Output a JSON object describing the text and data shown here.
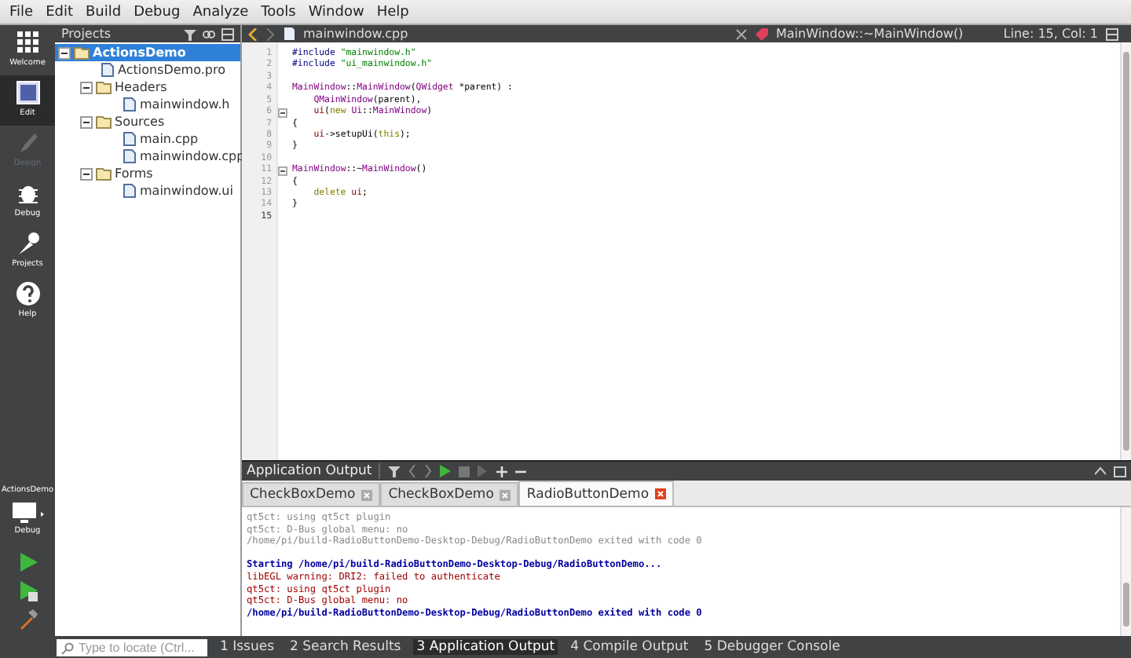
{
  "menu": [
    "File",
    "Edit",
    "Build",
    "Debug",
    "Analyze",
    "Tools",
    "Window",
    "Help"
  ],
  "modes": [
    {
      "label": "Welcome",
      "selected": false,
      "disabled": false
    },
    {
      "label": "Edit",
      "selected": true,
      "disabled": false
    },
    {
      "label": "Design",
      "selected": false,
      "disabled": true
    },
    {
      "label": "Debug",
      "selected": false,
      "disabled": false
    },
    {
      "label": "Projects",
      "selected": false,
      "disabled": false
    },
    {
      "label": "Help",
      "selected": false,
      "disabled": false
    }
  ],
  "target": {
    "project": "ActionsDemo",
    "config": "Debug"
  },
  "projects": {
    "title": "Projects",
    "tree": [
      {
        "label": "ActionsDemo",
        "selected": true,
        "expanded": true,
        "children": [
          {
            "label": "ActionsDemo.pro",
            "selected": false
          },
          {
            "label": "Headers",
            "selected": false,
            "expanded": true,
            "children": [
              {
                "label": "mainwindow.h",
                "selected": false
              }
            ]
          },
          {
            "label": "Sources",
            "selected": false,
            "expanded": true,
            "children": [
              {
                "label": "main.cpp",
                "selected": false
              },
              {
                "label": "mainwindow.cpp",
                "selected": false
              }
            ]
          },
          {
            "label": "Forms",
            "selected": false,
            "expanded": true,
            "children": [
              {
                "label": "mainwindow.ui",
                "selected": false
              }
            ]
          }
        ]
      }
    ]
  },
  "editor": {
    "file": "mainwindow.cpp",
    "symbol": "MainWindow::~MainWindow()",
    "position": "Line: 15, Col: 1",
    "lines": [
      {
        "number": "1",
        "indented": false,
        "foldable": false,
        "tokens": [
          {
            "text": "#include",
            "kind": "preproc"
          },
          {
            "text": " \"mainwindow.h\"",
            "kind": "string"
          }
        ]
      },
      {
        "number": "2",
        "indented": false,
        "foldable": false,
        "tokens": [
          {
            "text": "#include",
            "kind": "preproc"
          },
          {
            "text": " \"ui_mainwindow.h\"",
            "kind": "string"
          }
        ]
      },
      {
        "number": "3",
        "foldable": false
      },
      {
        "number": "4",
        "indented": false,
        "foldable": false,
        "tokens": [
          {
            "text": "MainWindow",
            "kind": "type"
          },
          {
            "text": "::",
            "kind": "plain"
          },
          {
            "text": "MainWindow",
            "kind": "type"
          },
          {
            "text": "(",
            "kind": "plain"
          },
          {
            "text": "QWidget",
            "kind": "type"
          },
          {
            "text": " *parent) :",
            "kind": "plain"
          }
        ]
      },
      {
        "number": "5",
        "indented": true,
        "foldable": false,
        "tokens": [
          {
            "text": "QMainWindow",
            "kind": "type"
          },
          {
            "text": "(parent),",
            "kind": "plain"
          }
        ]
      },
      {
        "number": "6",
        "indented": true,
        "foldable": true,
        "tokens": [
          {
            "text": "ui",
            "kind": "member"
          },
          {
            "text": "(",
            "kind": "plain"
          },
          {
            "text": "new",
            "kind": "keyword"
          },
          {
            "text": " Ui",
            "kind": "type"
          },
          {
            "text": "::",
            "kind": "plain"
          },
          {
            "text": "MainWindow",
            "kind": "type"
          },
          {
            "text": ")",
            "kind": "plain"
          }
        ]
      },
      {
        "number": "7",
        "indented": false,
        "foldable": false,
        "tokens": [
          {
            "text": "{",
            "kind": "plain"
          }
        ]
      },
      {
        "number": "8",
        "indented": true,
        "foldable": false,
        "tokens": [
          {
            "text": "ui",
            "kind": "member"
          },
          {
            "text": "->setupUi(",
            "kind": "plain"
          },
          {
            "text": "this",
            "kind": "keyword"
          },
          {
            "text": ");",
            "kind": "plain"
          }
        ]
      },
      {
        "number": "9",
        "indented": false,
        "foldable": false,
        "tokens": [
          {
            "text": "}",
            "kind": "plain"
          }
        ]
      },
      {
        "number": "10",
        "foldable": false
      },
      {
        "number": "11",
        "indented": false,
        "foldable": true,
        "tokens": [
          {
            "text": "MainWindow",
            "kind": "type"
          },
          {
            "text": "::~",
            "kind": "plain"
          },
          {
            "text": "MainWindow",
            "kind": "type"
          },
          {
            "text": "()",
            "kind": "plain"
          }
        ]
      },
      {
        "number": "12",
        "indented": false,
        "foldable": false,
        "tokens": [
          {
            "text": "{",
            "kind": "plain"
          }
        ]
      },
      {
        "number": "13",
        "indented": true,
        "foldable": false,
        "tokens": [
          {
            "text": "delete",
            "kind": "keyword"
          },
          {
            "text": " ui",
            "kind": "member"
          },
          {
            "text": ";",
            "kind": "plain"
          }
        ]
      },
      {
        "number": "14",
        "indented": false,
        "foldable": false,
        "tokens": [
          {
            "text": "}",
            "kind": "plain"
          }
        ]
      },
      {
        "number": "15",
        "foldable": false
      }
    ]
  },
  "output": {
    "title": "Application Output",
    "tabs": [
      {
        "label": "CheckBoxDemo",
        "selected": false
      },
      {
        "label": "CheckBoxDemo",
        "selected": false
      },
      {
        "label": "RadioButtonDemo",
        "selected": true
      }
    ],
    "lines": [
      {
        "kind": "old",
        "text": "qt5ct: using qt5ct plugin"
      },
      {
        "kind": "old",
        "text": "qt5ct: D-Bus global menu: no"
      },
      {
        "kind": "old",
        "text": "/home/pi/build-RadioButtonDemo-Desktop-Debug/RadioButtonDemo exited with code 0"
      },
      {
        "kind": "blank"
      },
      {
        "kind": "info",
        "text": "Starting /home/pi/build-RadioButtonDemo-Desktop-Debug/RadioButtonDemo..."
      },
      {
        "kind": "error",
        "text": "libEGL warning: DRI2: failed to authenticate"
      },
      {
        "kind": "error",
        "text": "qt5ct: using qt5ct plugin"
      },
      {
        "kind": "error",
        "text": "qt5ct: D-Bus global menu: no"
      },
      {
        "kind": "info",
        "text": "/home/pi/build-RadioButtonDemo-Desktop-Debug/RadioButtonDemo exited with code 0"
      }
    ]
  },
  "status_bar": {
    "locate_placeholder": "Type to locate (Ctrl...",
    "panes": [
      {
        "label": "1 Issues",
        "selected": false
      },
      {
        "label": "2 Search Results",
        "selected": false
      },
      {
        "label": "3 Application Output",
        "selected": true
      },
      {
        "label": "4 Compile Output",
        "selected": false
      },
      {
        "label": "5 Debugger Console",
        "selected": false
      }
    ]
  }
}
